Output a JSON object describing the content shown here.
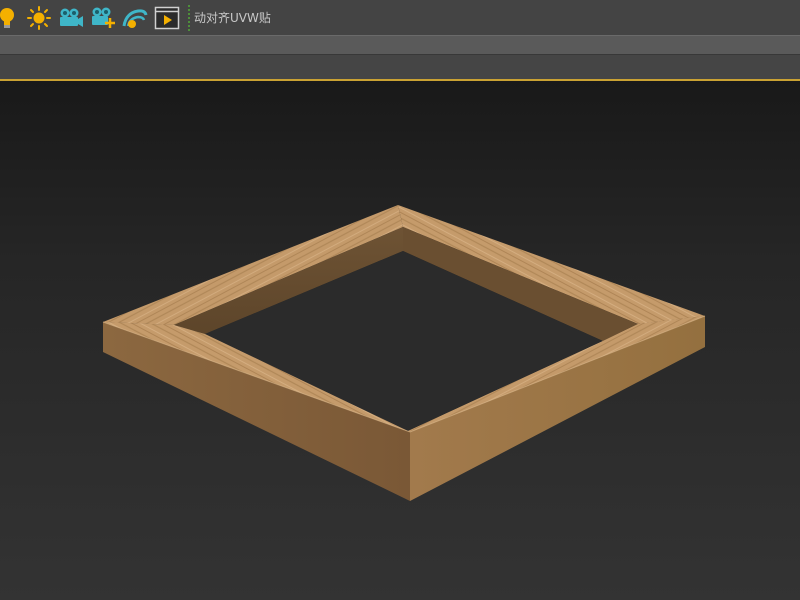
{
  "toolbar": {
    "buttons": [
      {
        "name": "light-bulb-icon",
        "label": ""
      },
      {
        "name": "sun-icon",
        "label": ""
      },
      {
        "name": "camera-icon",
        "label": ""
      },
      {
        "name": "camera-add-icon",
        "label": ""
      },
      {
        "name": "curve-icon",
        "label": ""
      },
      {
        "name": "play-render-icon",
        "label": ""
      }
    ],
    "label": "动对齐UVW贴"
  },
  "colors": {
    "toolbar_bg": "#444444",
    "accent": "#caa233",
    "wood_light": "#c9a06f",
    "wood_dark": "#7a5a3a"
  },
  "viewport": {
    "object": "wooden-square-frame"
  }
}
